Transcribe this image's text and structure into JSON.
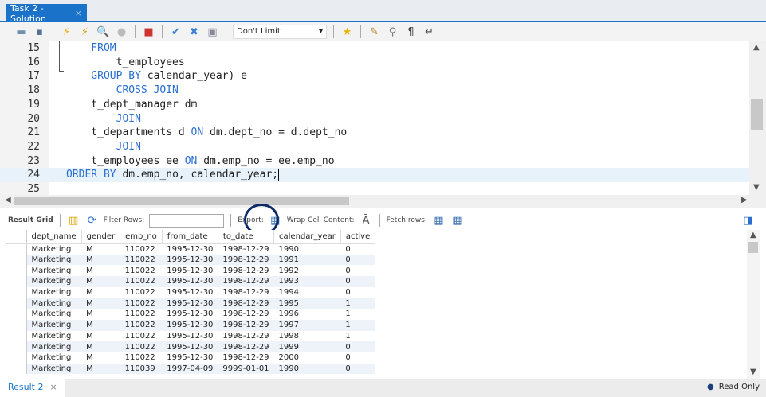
{
  "tab": {
    "title": "Task 2 - Solution",
    "close": "×"
  },
  "toolbar": {
    "limit": "Don't Limit"
  },
  "editor": {
    "lines": [
      {
        "n": "15",
        "code": [
          [
            "kw",
            "    FROM"
          ]
        ]
      },
      {
        "n": "16",
        "code": [
          [
            "",
            "        t_employees"
          ]
        ]
      },
      {
        "n": "17",
        "code": [
          [
            "kw",
            "    GROUP BY"
          ],
          [
            "",
            " calendar_year) e"
          ]
        ]
      },
      {
        "n": "18",
        "code": [
          [
            "kw",
            "        CROSS JOIN"
          ]
        ]
      },
      {
        "n": "19",
        "code": [
          [
            "",
            "    t_dept_manager dm"
          ]
        ]
      },
      {
        "n": "20",
        "code": [
          [
            "kw",
            "        JOIN"
          ]
        ]
      },
      {
        "n": "21",
        "code": [
          [
            "",
            "    t_departments d "
          ],
          [
            "kw",
            "ON"
          ],
          [
            "",
            " dm.dept_no = d.dept_no"
          ]
        ]
      },
      {
        "n": "22",
        "code": [
          [
            "kw",
            "        JOIN"
          ]
        ]
      },
      {
        "n": "23",
        "code": [
          [
            "",
            "    t_employees ee "
          ],
          [
            "kw",
            "ON"
          ],
          [
            "",
            " dm.emp_no = ee.emp_no"
          ]
        ]
      },
      {
        "n": "24",
        "code": [
          [
            "kw",
            "ORDER BY"
          ],
          [
            "",
            " dm.emp_no, calendar_year;"
          ]
        ]
      },
      {
        "n": "25",
        "code": []
      }
    ]
  },
  "results": {
    "grid_label": "Result Grid",
    "filter_label": "Filter Rows:",
    "export_label": "Export:",
    "wrap_label": "Wrap Cell Content:",
    "fetch_label": "Fetch rows:",
    "columns": [
      "dept_name",
      "gender",
      "emp_no",
      "from_date",
      "to_date",
      "calendar_year",
      "active"
    ],
    "rows": [
      [
        "Marketing",
        "M",
        "110022",
        "1995-12-30",
        "1998-12-29",
        "1990",
        "0"
      ],
      [
        "Marketing",
        "M",
        "110022",
        "1995-12-30",
        "1998-12-29",
        "1991",
        "0"
      ],
      [
        "Marketing",
        "M",
        "110022",
        "1995-12-30",
        "1998-12-29",
        "1992",
        "0"
      ],
      [
        "Marketing",
        "M",
        "110022",
        "1995-12-30",
        "1998-12-29",
        "1993",
        "0"
      ],
      [
        "Marketing",
        "M",
        "110022",
        "1995-12-30",
        "1998-12-29",
        "1994",
        "0"
      ],
      [
        "Marketing",
        "M",
        "110022",
        "1995-12-30",
        "1998-12-29",
        "1995",
        "1"
      ],
      [
        "Marketing",
        "M",
        "110022",
        "1995-12-30",
        "1998-12-29",
        "1996",
        "1"
      ],
      [
        "Marketing",
        "M",
        "110022",
        "1995-12-30",
        "1998-12-29",
        "1997",
        "1"
      ],
      [
        "Marketing",
        "M",
        "110022",
        "1995-12-30",
        "1998-12-29",
        "1998",
        "1"
      ],
      [
        "Marketing",
        "M",
        "110022",
        "1995-12-30",
        "1998-12-29",
        "1999",
        "0"
      ],
      [
        "Marketing",
        "M",
        "110022",
        "1995-12-30",
        "1998-12-29",
        "2000",
        "0"
      ],
      [
        "Marketing",
        "M",
        "110039",
        "1997-04-09",
        "9999-01-01",
        "1990",
        "0"
      ]
    ]
  },
  "status": {
    "result_tab": "Result 2",
    "close": "×",
    "read_only": "Read Only"
  }
}
